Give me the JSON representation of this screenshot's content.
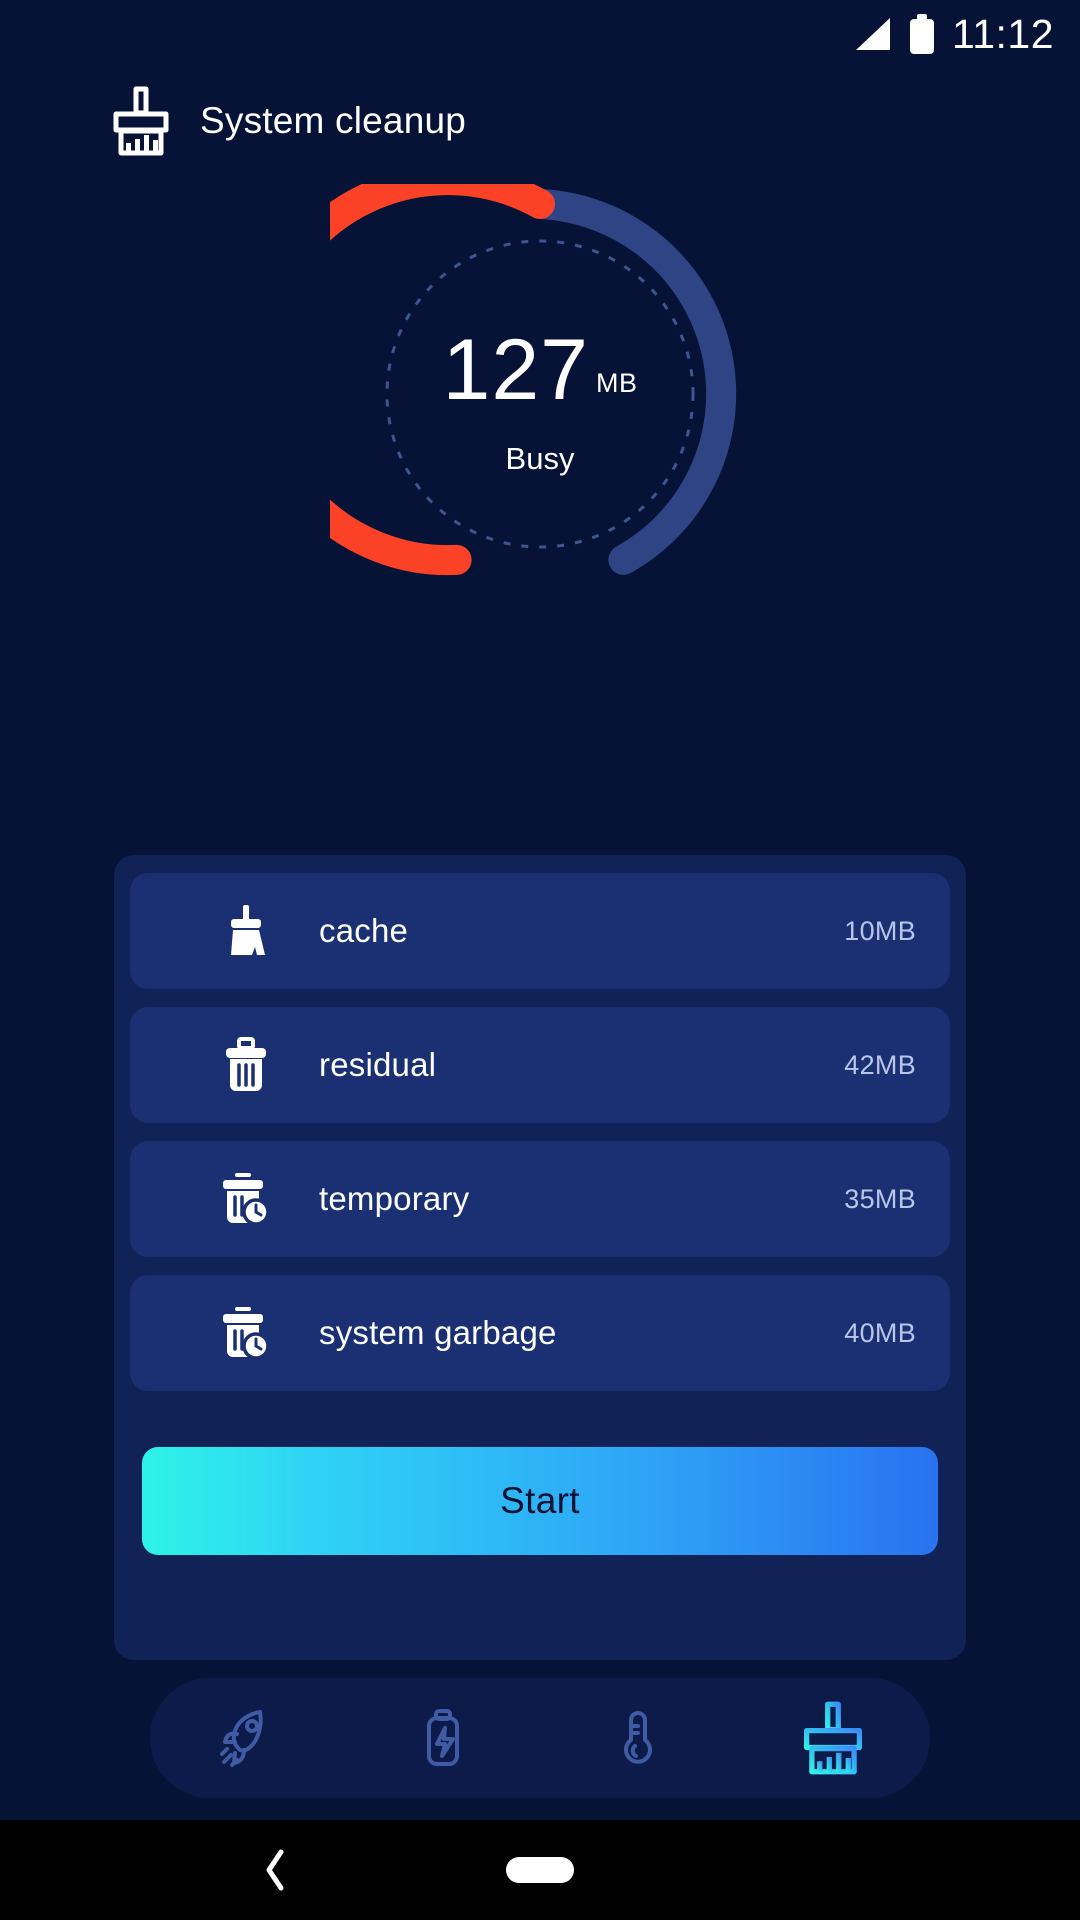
{
  "status_bar": {
    "time": "11:12",
    "signal_icon": "signal-triangle-icon",
    "battery_icon": "battery-full-icon"
  },
  "header": {
    "title": "System cleanup",
    "icon": "brush-icon"
  },
  "gauge": {
    "value": "127",
    "unit": "MB",
    "status": "Busy",
    "progress_color": "#FB4226",
    "track_color": "#2F4485",
    "dotted_ring_color": "#3d5590",
    "percent": 62
  },
  "cleanup_items": [
    {
      "icon": "broom-icon",
      "label": "cache",
      "size": "10MB"
    },
    {
      "icon": "trash-icon",
      "label": "residual",
      "size": "42MB"
    },
    {
      "icon": "trash-clock-icon",
      "label": "temporary",
      "size": "35MB"
    },
    {
      "icon": "trash-clock-icon",
      "label": "system garbage",
      "size": "40MB"
    }
  ],
  "action": {
    "start_label": "Start",
    "gradient_from": "#2EF3E8",
    "gradient_to": "#2A72F0"
  },
  "bottom_nav": [
    {
      "icon": "rocket-icon",
      "name": "boost",
      "active": false
    },
    {
      "icon": "battery-bolt-icon",
      "name": "power",
      "active": false
    },
    {
      "icon": "thermometer-icon",
      "name": "cooling",
      "active": false
    },
    {
      "icon": "brush-icon",
      "name": "cleanup",
      "active": true
    }
  ],
  "system_nav": {
    "back_icon": "chevron-left-icon",
    "home_icon": "home-pill-icon"
  },
  "theme": {
    "background": "#071336",
    "panel": "#112256",
    "row": "#1A3073",
    "accent": "#2EF3E8"
  }
}
